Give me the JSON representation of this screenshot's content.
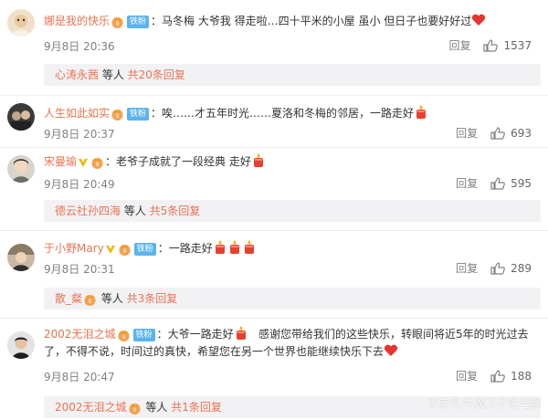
{
  "comments": [
    {
      "username": "娜是我的快乐",
      "badge": "铁粉",
      "text": "：马冬梅 大爷我 得走啦…四十平米的小屋 虽小 但日子也要好好过",
      "time": "9月8日 20:36",
      "reply": "回复",
      "likes": "1537",
      "sub": {
        "user": "心涛永茜",
        "mid": " 等人 ",
        "count": "共20条回复"
      }
    },
    {
      "username": "人生如此如实",
      "badge": "铁粉",
      "text": "：唉……才五年时光……夏洛和冬梅的邻居，一路走好",
      "time": "9月8日 20:37",
      "reply": "回复",
      "likes": "693"
    },
    {
      "username": "宋曼瑜",
      "text": "：老爷子成就了一段经典 走好",
      "time": "9月8日 20:49",
      "reply": "回复",
      "likes": "595",
      "sub": {
        "user": "德云社孙四海",
        "mid": " 等人 ",
        "count": "共5条回复"
      }
    },
    {
      "username": "于小野Mary",
      "badge": "铁粉",
      "text": "：一路走好",
      "time": "9月8日 20:31",
      "reply": "回复",
      "likes": "289",
      "sub": {
        "user": "散_粲",
        "mid": " 等人 ",
        "count": "共3条回复"
      }
    },
    {
      "username": "2002无泪之城",
      "badge": "铁粉",
      "text_a": "：大爷一路走好",
      "text_b": "感谢您带给我们的这些快乐，转眼间将近5年的时光过去了，不得不说，时间过的真快，希望您在另一个世界也能继续快乐下去",
      "time": "9月8日 20:47",
      "reply": "回复",
      "likes": "188",
      "sub": {
        "user": "2002无泪之城",
        "mid": " 等人 ",
        "count": "共1条回复"
      }
    }
  ],
  "watermark": "百家号/牛魔王子说电影",
  "colors": {
    "username": "#eb7350",
    "badge": "#5ab4f0",
    "meta": "#808080",
    "sub_bg": "#f2f2f5"
  },
  "icons": [
    "crown-icon",
    "candle-icon",
    "heart-icon",
    "vip-icon",
    "thumbs-up-icon"
  ]
}
